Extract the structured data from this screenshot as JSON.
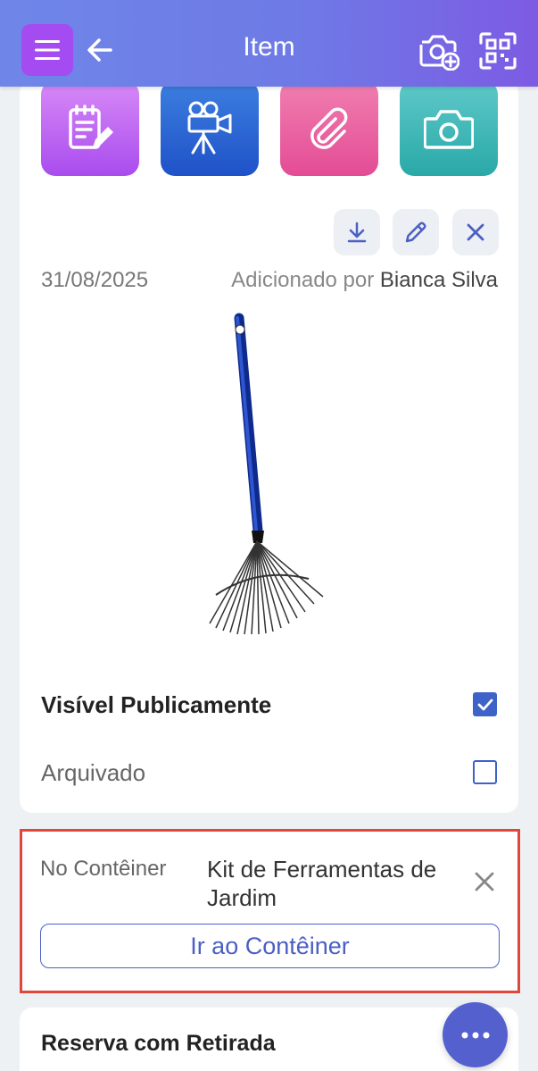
{
  "header": {
    "title": "Item",
    "icons": [
      "menu-icon",
      "back-arrow-icon",
      "add-photo-icon",
      "qr-scan-icon"
    ]
  },
  "tiles": [
    {
      "icon": "note-edit-icon",
      "color": "#b25cf0"
    },
    {
      "icon": "video-camera-icon",
      "color": "#2b66d6"
    },
    {
      "icon": "paperclip-icon",
      "color": "#ea64a2"
    },
    {
      "icon": "camera-icon",
      "color": "#3cb5b5"
    }
  ],
  "photo": {
    "actions": [
      "download-icon",
      "edit-icon",
      "delete-icon"
    ],
    "date": "31/08/2025",
    "added_by_label": "Adicionado por",
    "added_by_name": "Bianca Silva"
  },
  "flags": {
    "public_label": "Visível Publicamente",
    "public_checked": true,
    "archived_label": "Arquivado",
    "archived_checked": false
  },
  "container": {
    "label": "No Contêiner",
    "value": "Kit de Ferramentas de Jardim",
    "button_label": "Ir ao Contêiner"
  },
  "reservation": {
    "title": "Reserva com Retirada"
  },
  "fab": {
    "icon": "more-dots-icon"
  },
  "colors": {
    "accent": "#4b5fc4",
    "highlight_border": "#e0463a",
    "menu_button": "#a54bf2"
  }
}
